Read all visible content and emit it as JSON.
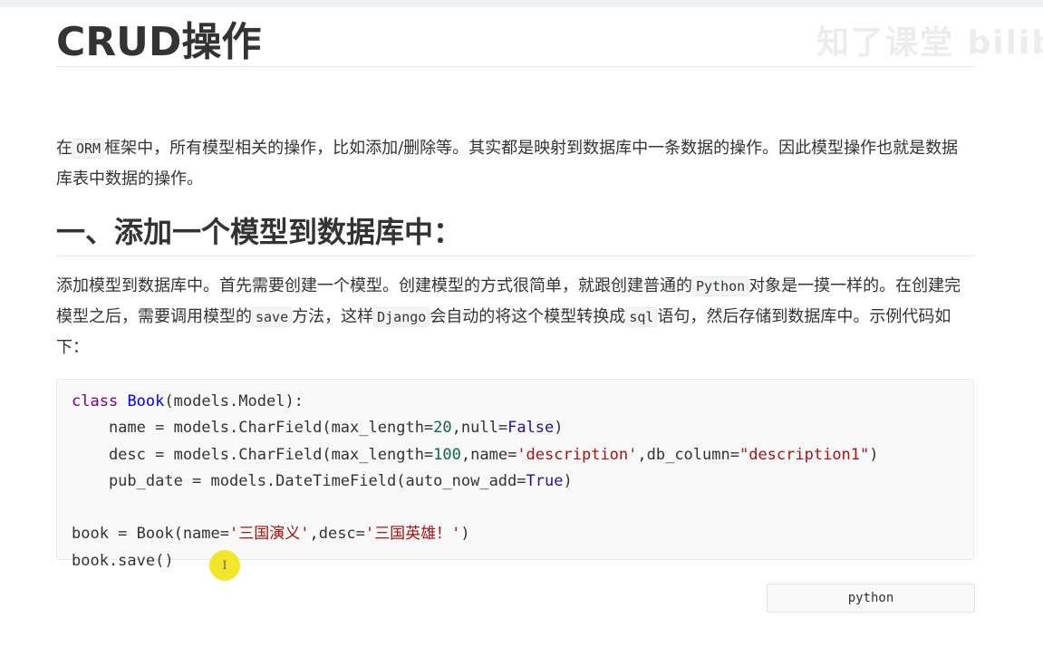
{
  "watermark": "知了课堂 bilibili",
  "title": "CRUD操作",
  "intro": {
    "before": "在",
    "code": "ORM",
    "after": "框架中，所有模型相关的操作，比如添加/删除等。其实都是映射到数据库中一条数据的操作。因此模型操作也就是数据库表中数据的操作。"
  },
  "section1": {
    "heading": "一、添加一个模型到数据库中：",
    "para": {
      "t1": "添加模型到数据库中。首先需要创建一个模型。创建模型的方式很简单，就跟创建普通的",
      "c1": "Python",
      "t2": "对象是一摸一样的。在创建完模型之后，需要调用模型的",
      "c2": "save",
      "t3": "方法，这样",
      "c3": "Django",
      "t4": "会自动的将这个模型转换成",
      "c4": "sql",
      "t5": "语句，然后存储到数据库中。示例代码如下："
    }
  },
  "code": {
    "l1_kw": "class",
    "l1_def": "Book",
    "l1_rest": "(models.Model):",
    "l2_a": "    name = models.CharField(max_length=",
    "l2_num": "20",
    "l2_b": ",null=",
    "l2_atom": "False",
    "l2_c": ")",
    "l3_a": "    desc = models.CharField(max_length=",
    "l3_num": "100",
    "l3_b": ",name=",
    "l3_str1": "'description'",
    "l3_c": ",db_column=",
    "l3_str2": "\"description1\"",
    "l3_d": ")",
    "l4_a": "    pub_date = models.DateTimeField(auto_now_add=",
    "l4_atom": "True",
    "l4_b": ")",
    "l6_a": "book = Book(name=",
    "l6_str1": "'三国演义'",
    "l6_b": ",desc=",
    "l6_str2": "'三国英雄！'",
    "l6_c": ")",
    "l7": "book.save()"
  },
  "cursor_glyph": "I",
  "language_label": "python",
  "colors": {
    "keyword": "#770088",
    "definition": "#0000ff",
    "number": "#116644",
    "string": "#aa1111",
    "atom": "#221199",
    "cursor_highlight": "#f3e419"
  }
}
